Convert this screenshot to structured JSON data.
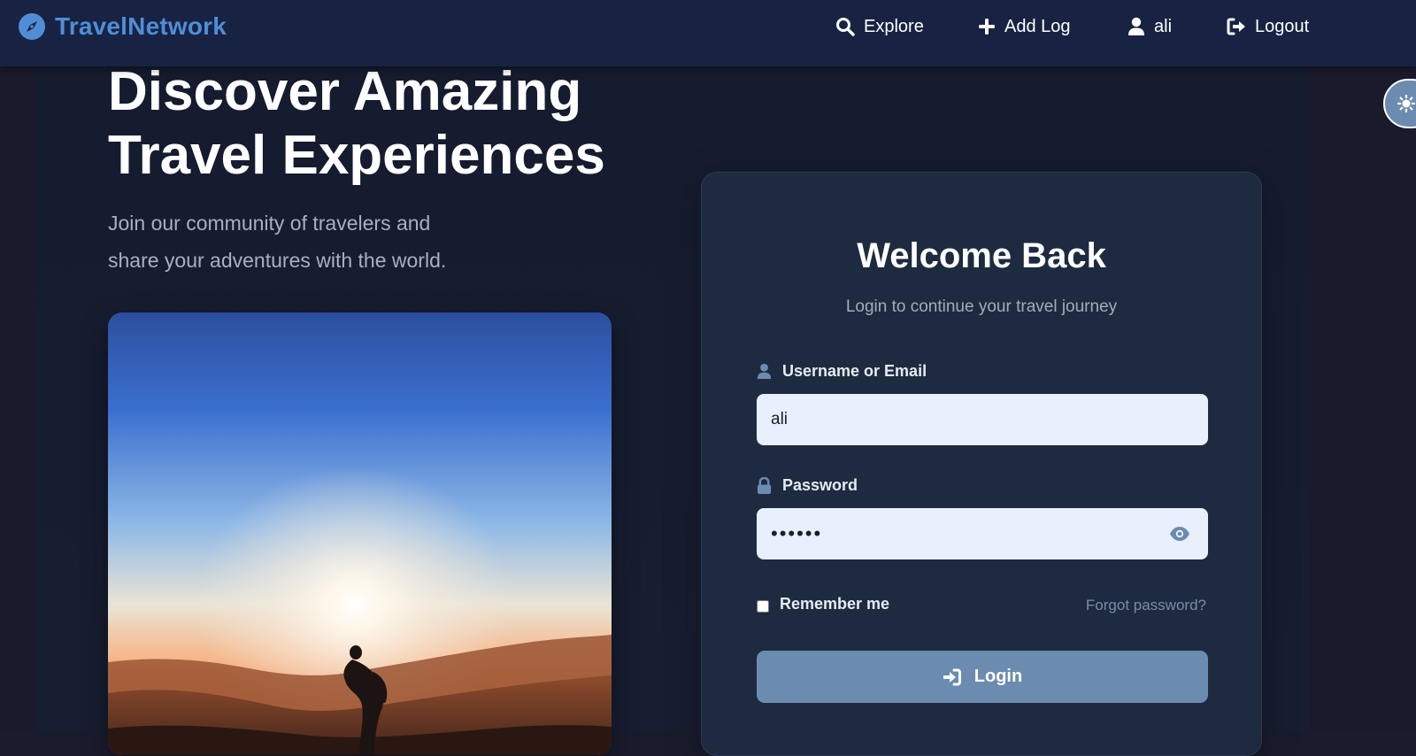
{
  "navbar": {
    "brand": "TravelNetwork",
    "links": {
      "explore": "Explore",
      "add_log": "Add Log",
      "user": "ali",
      "logout": "Logout"
    }
  },
  "hero": {
    "title_line1": "Discover Amazing",
    "title_line2": "Travel Experiences",
    "subtitle_line1": "Join our community of travelers and",
    "subtitle_line2": "share your adventures with the world."
  },
  "login": {
    "title": "Welcome Back",
    "subtitle": "Login to continue your travel journey",
    "username_label": "Username or Email",
    "username_value": "ali",
    "password_label": "Password",
    "password_value": "••••••",
    "remember_label": "Remember me",
    "remember_checked": false,
    "forgot_label": "Forgot password?",
    "submit_label": "Login"
  },
  "icons": {
    "brand": "compass-icon",
    "explore": "search-icon",
    "add_log": "plus-icon",
    "user": "user-icon",
    "logout": "sign-out-icon",
    "username_field": "user-icon",
    "password_field": "lock-icon",
    "password_toggle": "eye-icon",
    "submit": "sign-in-icon",
    "theme_toggle": "sun-icon"
  },
  "colors": {
    "brand": "#4f8ed6",
    "navbar_bg": "#182343",
    "card_bg": "#1e2a3f",
    "input_bg": "#e8f0fe",
    "button_bg": "#6b8cb0",
    "link_muted": "#7a8ca8"
  }
}
